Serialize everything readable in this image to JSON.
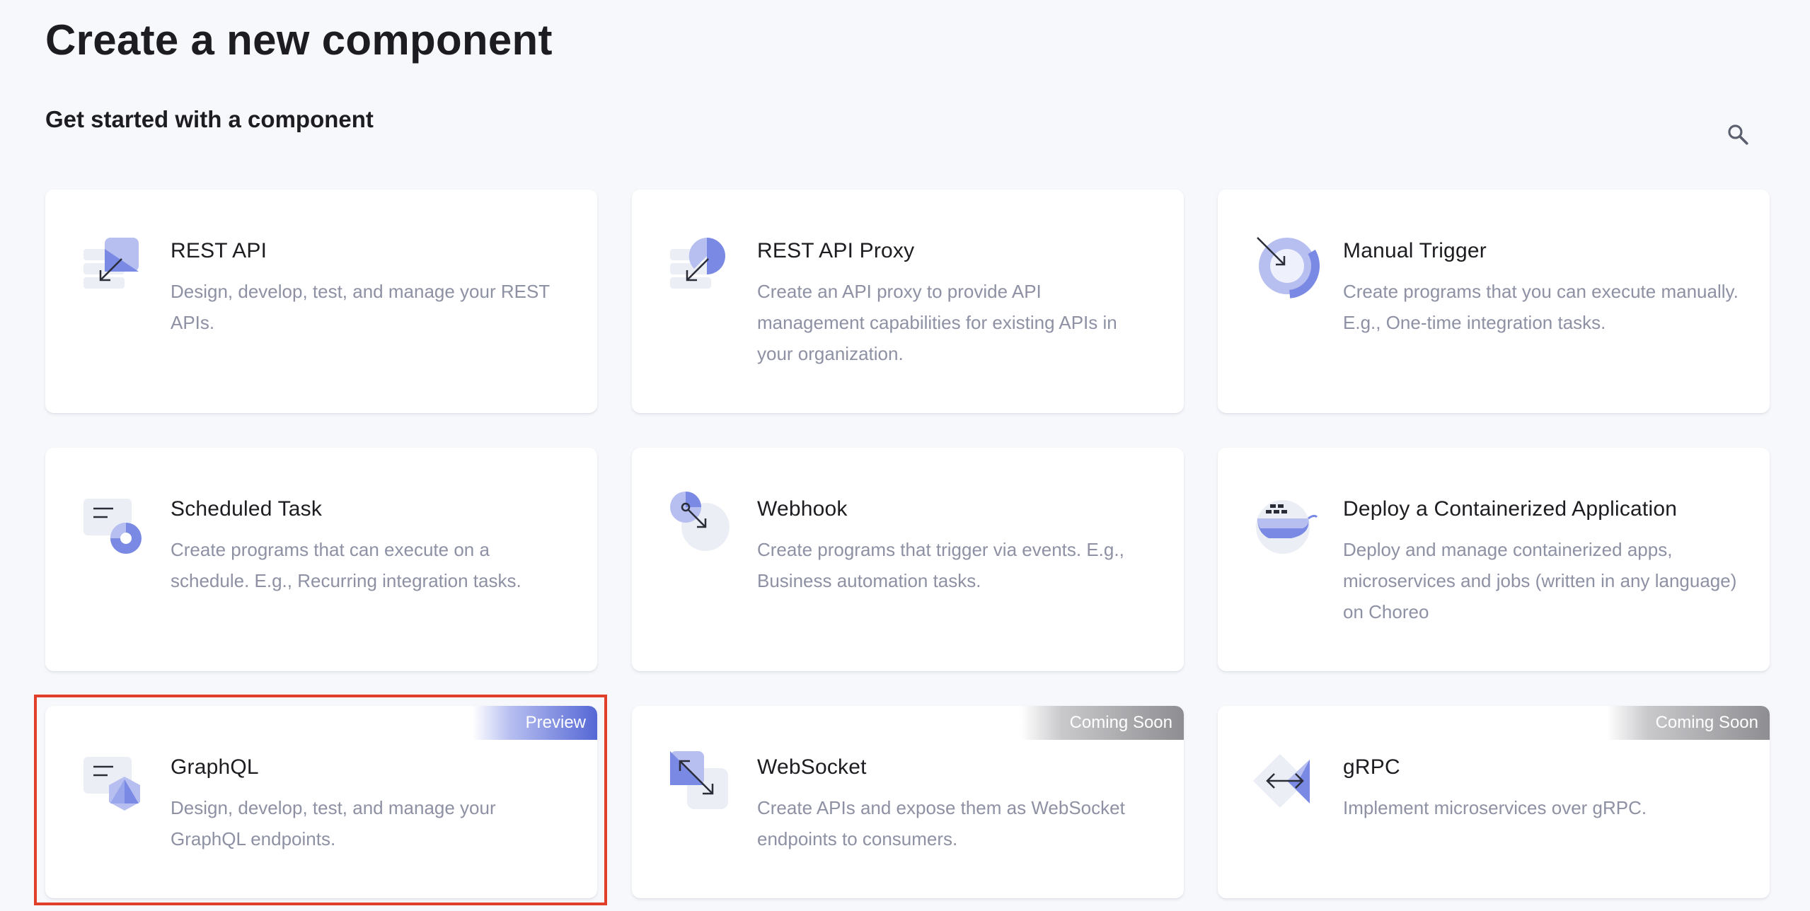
{
  "page": {
    "title": "Create a new component",
    "section_title": "Get started with a component"
  },
  "search": {
    "icon": "search-icon"
  },
  "cards": [
    {
      "title": "REST API",
      "description": "Design, develop, test, and manage your REST APIs.",
      "icon": "rest-api-icon",
      "badge": ""
    },
    {
      "title": "REST API Proxy",
      "description": "Create an API proxy to provide API management capabilities for existing APIs in your organization.",
      "icon": "rest-api-proxy-icon",
      "badge": ""
    },
    {
      "title": "Manual Trigger",
      "description": "Create programs that you can execute manually. E.g., One-time integration tasks.",
      "icon": "manual-trigger-icon",
      "badge": ""
    },
    {
      "title": "Scheduled Task",
      "description": "Create programs that can execute on a schedule. E.g., Recurring integration tasks.",
      "icon": "scheduled-task-icon",
      "badge": ""
    },
    {
      "title": "Webhook",
      "description": "Create programs that trigger via events. E.g., Business automation tasks.",
      "icon": "webhook-icon",
      "badge": ""
    },
    {
      "title": "Deploy a Containerized Application",
      "description": "Deploy and manage containerized apps, microservices and jobs (written in any language) on Choreo",
      "icon": "container-icon",
      "badge": ""
    },
    {
      "title": "GraphQL",
      "description": "Design, develop, test, and manage your GraphQL endpoints.",
      "icon": "graphql-icon",
      "badge": "Preview"
    },
    {
      "title": "WebSocket",
      "description": "Create APIs and expose them as WebSocket endpoints to consumers.",
      "icon": "websocket-icon",
      "badge": "Coming Soon"
    },
    {
      "title": "gRPC",
      "description": "Implement microservices over gRPC.",
      "icon": "grpc-icon",
      "badge": "Coming Soon"
    }
  ],
  "colors": {
    "accent": "#5567d5",
    "accent_light": "#b7bff0",
    "highlight": "#e0402a",
    "muted_text": "#8d91a3"
  }
}
